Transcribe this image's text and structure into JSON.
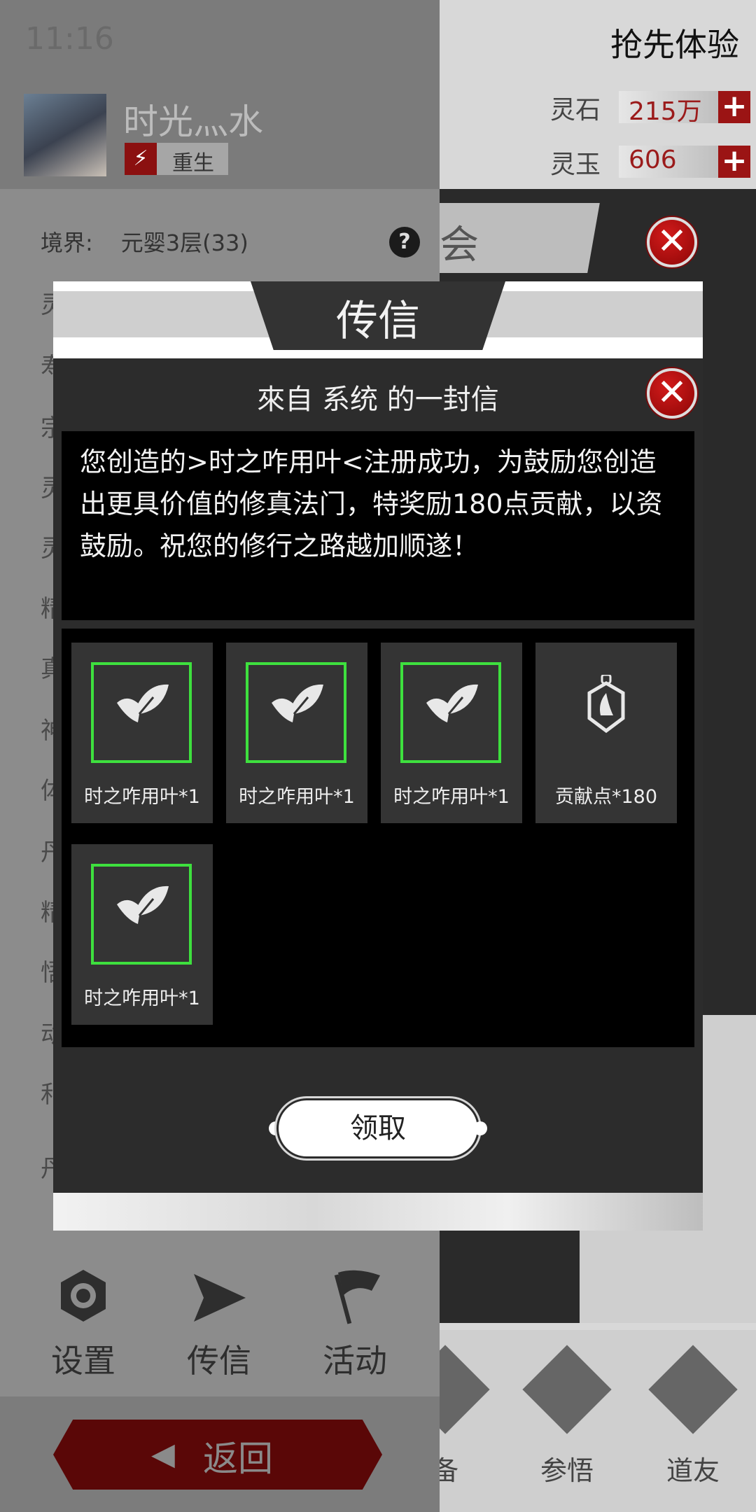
{
  "status_bar": {
    "time": "11:16"
  },
  "header": {
    "early_access": "抢先体验"
  },
  "resources": [
    {
      "label": "灵石",
      "value": "215万",
      "plus": "+"
    },
    {
      "label": "灵玉",
      "value": "606",
      "plus": "+"
    }
  ],
  "player": {
    "name": "时光灬水",
    "rebirth": "重生",
    "realm_label": "境界:",
    "realm_value": "元婴3层(33)",
    "help": "?"
  },
  "side_list": [
    "灵",
    "寿",
    "宗",
    "灵",
    "灵",
    "精",
    "真",
    "神",
    "体",
    "丹",
    "精",
    "悟",
    "动",
    "和",
    "丹"
  ],
  "bg_banner": "会",
  "quick_actions": [
    {
      "label": "设置",
      "icon": "gear-icon"
    },
    {
      "label": "传信",
      "icon": "send-icon"
    },
    {
      "label": "活动",
      "icon": "flag-icon"
    }
  ],
  "back_button": {
    "label": "返回"
  },
  "bottom_nav": [
    {
      "label": "备"
    },
    {
      "label": "参悟"
    },
    {
      "label": "道友"
    }
  ],
  "modal": {
    "title": "传信",
    "close": "✕",
    "header": "來自  系统  的一封信",
    "body": "您创造的>时之咋用叶<注册成功，为鼓励您创造出更具价值的修真法门，特奖励180点贡献，以资鼓励。祝您的修行之路越加顺遂！",
    "rewards": [
      {
        "label": "时之咋用叶*1",
        "icon": "leaf-icon"
      },
      {
        "label": "时之咋用叶*1",
        "icon": "leaf-icon"
      },
      {
        "label": "时之咋用叶*1",
        "icon": "leaf-icon"
      },
      {
        "label": "贡献点*180",
        "icon": "contribution-token-icon"
      },
      {
        "label": "时之咋用叶*1",
        "icon": "leaf-icon"
      }
    ],
    "claim_label": "领取"
  },
  "colors": {
    "accent_red": "#9b1414",
    "item_border_green": "#3ee03e"
  }
}
